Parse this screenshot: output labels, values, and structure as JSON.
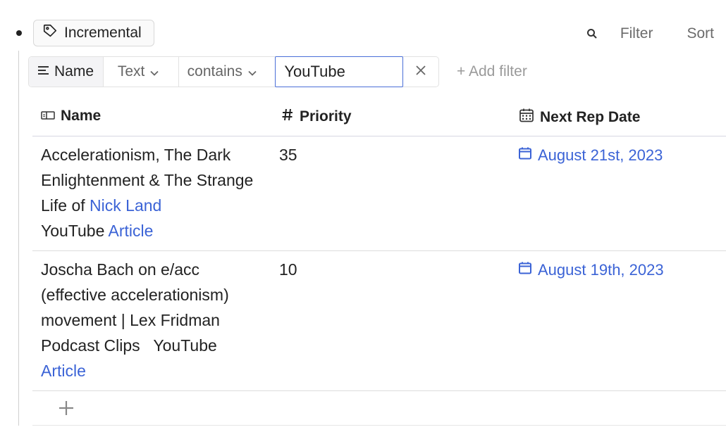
{
  "block": {
    "tag_label": "Incremental",
    "actions": {
      "filter_label": "Filter",
      "sort_label": "Sort"
    }
  },
  "filter": {
    "property_label": "Name",
    "type_label": "Text",
    "operator_label": "contains",
    "value": "YouTube",
    "add_filter_label": "+ Add filter"
  },
  "table": {
    "columns": [
      {
        "label": "Name",
        "icon": "name-property-icon"
      },
      {
        "label": "Priority",
        "icon": "hash-icon"
      },
      {
        "label": "Next Rep Date",
        "icon": "calendar-icon"
      }
    ],
    "rows": [
      {
        "title": "Accelerationism, The Dark Enlightenment & The Strange Life of",
        "link": "Nick Land",
        "source": "YouTube",
        "article": "Article",
        "priority": "35",
        "next_rep_date": "August 21st, 2023"
      },
      {
        "title": "Joscha Bach on e/acc (effective accelerationism) movement | Lex Fridman Podcast Clips",
        "source": "YouTube",
        "article": "Article",
        "priority": "10",
        "next_rep_date": "August 19th, 2023"
      }
    ]
  },
  "colors": {
    "link": "#3b63d6",
    "focus_border": "#4a6fd8"
  }
}
